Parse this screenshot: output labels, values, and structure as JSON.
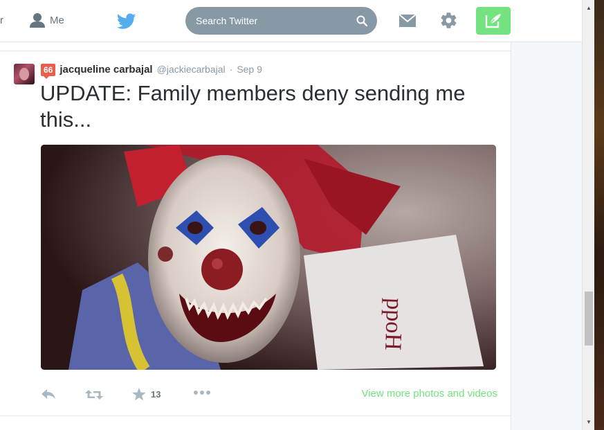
{
  "nav": {
    "partial_item": "r",
    "me_label": "Me",
    "search_placeholder": "Search Twitter"
  },
  "tweet": {
    "badge": "66",
    "fullname": "jacqueline carbajal",
    "username": "@jackiecarbajal",
    "separator": "·",
    "time": "Sep 9",
    "text": "UPDATE: Family members deny sending me this...",
    "favorite_count": "13",
    "view_more_label": "View more photos and videos"
  },
  "colors": {
    "accent_green": "#73e27f",
    "badge_red": "#e8604c",
    "search_bg": "#8899a6",
    "twitter_blue": "#55acee"
  },
  "icons": {
    "me": "person-icon",
    "bird": "twitter-bird-icon",
    "search": "magnifier-icon",
    "mail": "envelope-icon",
    "settings": "gear-icon",
    "compose": "quill-icon",
    "reply": "reply-arrow-icon",
    "retweet": "retweet-icon",
    "favorite": "star-icon",
    "more": "ellipsis-icon"
  }
}
